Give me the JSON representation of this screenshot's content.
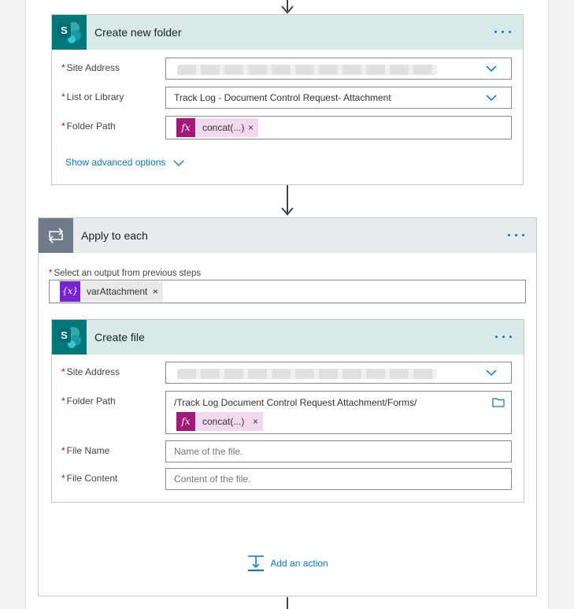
{
  "create_folder": {
    "title": "Create new folder",
    "fields": {
      "site_address_label": "Site Address",
      "list_label": "List or Library",
      "list_value": "Track Log - Document Control Request- Attachment",
      "folder_path_label": "Folder Path",
      "folder_token": "concat(...)"
    },
    "advanced_link": "Show advanced options"
  },
  "apply_each": {
    "title": "Apply to each",
    "select_label": "Select an output from previous steps",
    "var_token_icon": "{x}",
    "var_token": "varAttachment"
  },
  "create_file": {
    "title": "Create file",
    "fields": {
      "site_address_label": "Site Address",
      "folder_path_label": "Folder Path",
      "folder_path_value": "/Track Log  Document Control Request Attachment/Forms/",
      "folder_token": "concat(...)",
      "file_name_label": "File Name",
      "file_name_placeholder": "Name of the file.",
      "file_content_label": "File Content",
      "file_content_placeholder": "Content of the file."
    }
  },
  "add_action": "Add an action",
  "common": {
    "required_marker": "*",
    "remove_glyph": "×",
    "fx_glyph": "fx",
    "sp_letter": "S"
  },
  "colors": {
    "accent": "#0078d4",
    "sharepoint": "#03787c",
    "expression": "#a4187a",
    "variable": "#7a22d6"
  }
}
